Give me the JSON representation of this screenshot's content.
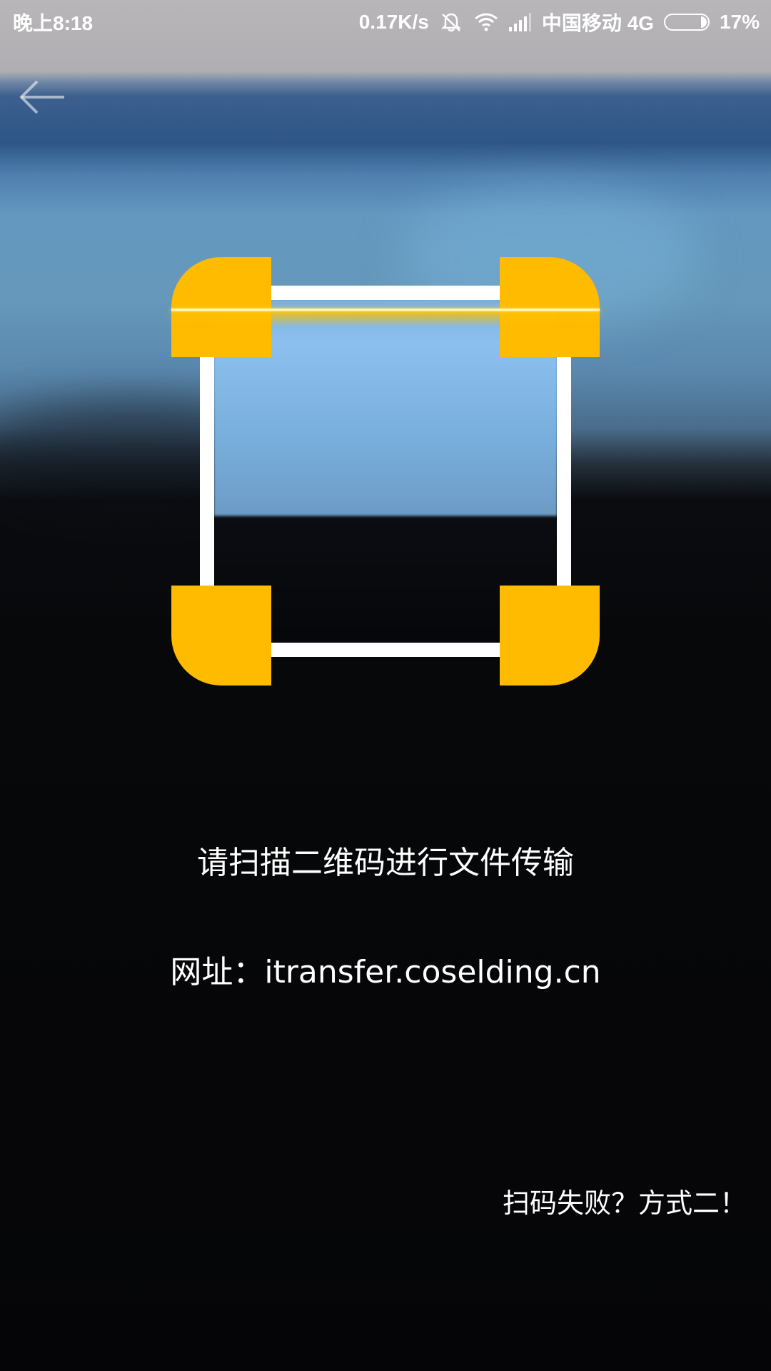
{
  "status_bar": {
    "time": "晚上8:18",
    "net_speed": "0.17K/s",
    "carrier": "中国移动 4G",
    "battery": "17%",
    "icons": [
      "mute-bell-icon",
      "wifi-icon",
      "signal-icon",
      "battery-icon"
    ]
  },
  "nav": {
    "back_icon": "arrow-left-icon"
  },
  "scanner": {
    "corner_color": "#ffbb00",
    "frame_color": "#ffffff",
    "scan_line_color": "#fff4b0"
  },
  "main": {
    "hint": "请扫描二维码进行文件传输",
    "url_label": "网址：itransfer.coselding.cn"
  },
  "footer": {
    "alt_method_link": "扫码失败？方式二！"
  }
}
